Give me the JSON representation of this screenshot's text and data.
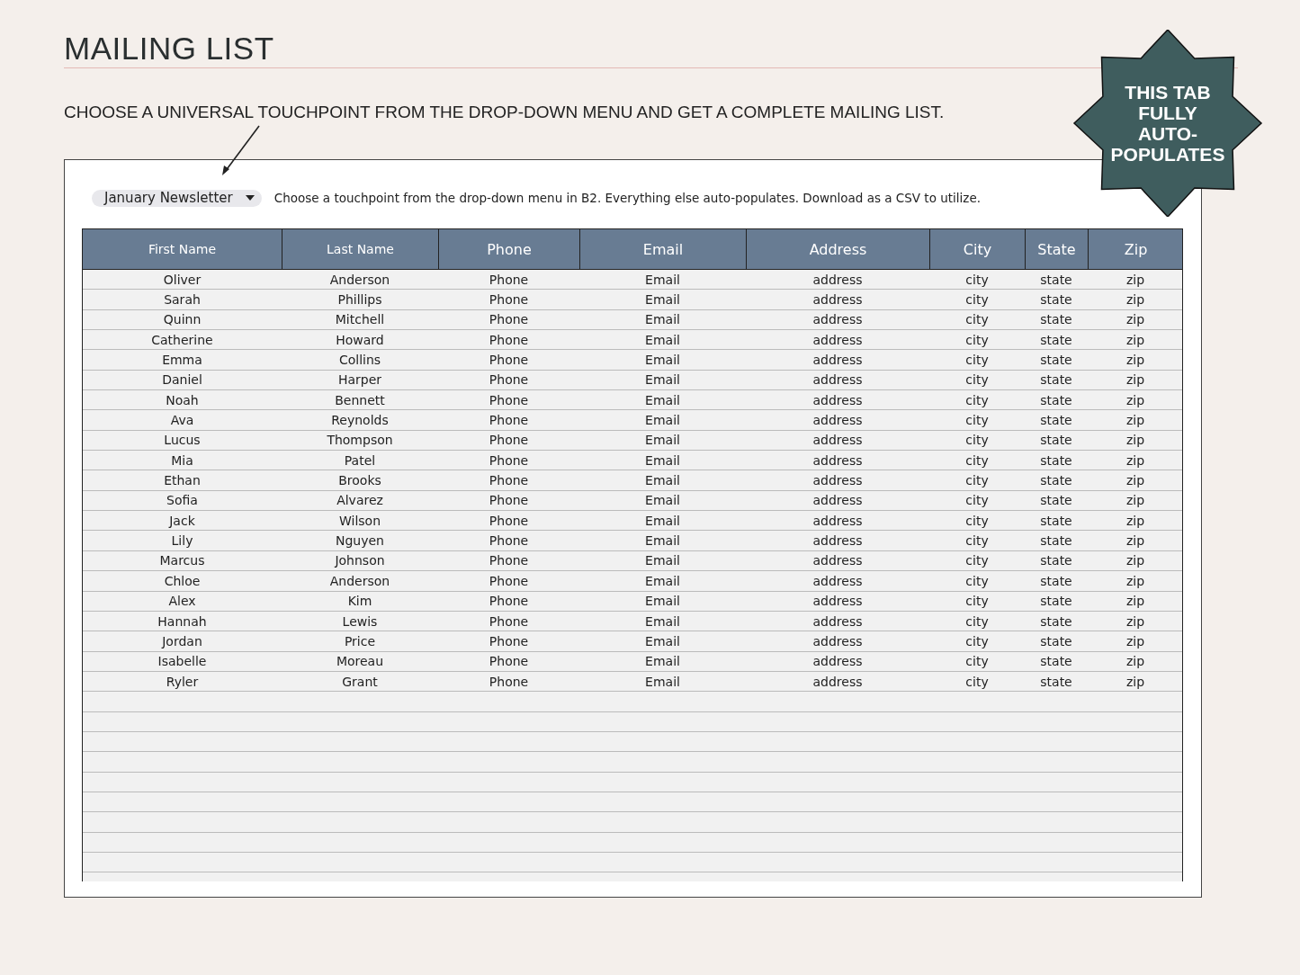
{
  "title": "MAILING LIST",
  "instruction": "CHOOSE A UNIVERSAL TOUCHPOINT FROM THE DROP-DOWN MENU AND GET A COMPLETE MAILING LIST.",
  "badge": [
    "THIS TAB",
    "FULLY",
    "AUTO-",
    "POPULATES"
  ],
  "touchpoint_dropdown": {
    "value": "January Newsletter"
  },
  "note": "Choose a touchpoint from the drop-down menu in B2. Everything else auto-populates. Download as a CSV to utilize.",
  "table": {
    "columns": [
      "First Name",
      "Last Name",
      "Phone",
      "Email",
      "Address",
      "City",
      "State",
      "Zip"
    ],
    "rows": [
      [
        "Oliver",
        "Anderson",
        "Phone",
        "Email",
        "address",
        "city",
        "state",
        "zip"
      ],
      [
        "Sarah",
        "Phillips",
        "Phone",
        "Email",
        "address",
        "city",
        "state",
        "zip"
      ],
      [
        "Quinn",
        "Mitchell",
        "Phone",
        "Email",
        "address",
        "city",
        "state",
        "zip"
      ],
      [
        "Catherine",
        "Howard",
        "Phone",
        "Email",
        "address",
        "city",
        "state",
        "zip"
      ],
      [
        "Emma",
        "Collins",
        "Phone",
        "Email",
        "address",
        "city",
        "state",
        "zip"
      ],
      [
        "Daniel",
        "Harper",
        "Phone",
        "Email",
        "address",
        "city",
        "state",
        "zip"
      ],
      [
        "Noah",
        "Bennett",
        "Phone",
        "Email",
        "address",
        "city",
        "state",
        "zip"
      ],
      [
        "Ava",
        "Reynolds",
        "Phone",
        "Email",
        "address",
        "city",
        "state",
        "zip"
      ],
      [
        "Lucus",
        "Thompson",
        "Phone",
        "Email",
        "address",
        "city",
        "state",
        "zip"
      ],
      [
        "Mia",
        "Patel",
        "Phone",
        "Email",
        "address",
        "city",
        "state",
        "zip"
      ],
      [
        "Ethan",
        "Brooks",
        "Phone",
        "Email",
        "address",
        "city",
        "state",
        "zip"
      ],
      [
        "Sofia",
        "Alvarez",
        "Phone",
        "Email",
        "address",
        "city",
        "state",
        "zip"
      ],
      [
        "Jack",
        "Wilson",
        "Phone",
        "Email",
        "address",
        "city",
        "state",
        "zip"
      ],
      [
        "Lily",
        "Nguyen",
        "Phone",
        "Email",
        "address",
        "city",
        "state",
        "zip"
      ],
      [
        "Marcus",
        "Johnson",
        "Phone",
        "Email",
        "address",
        "city",
        "state",
        "zip"
      ],
      [
        "Chloe",
        "Anderson",
        "Phone",
        "Email",
        "address",
        "city",
        "state",
        "zip"
      ],
      [
        "Alex",
        "Kim",
        "Phone",
        "Email",
        "address",
        "city",
        "state",
        "zip"
      ],
      [
        "Hannah",
        "Lewis",
        "Phone",
        "Email",
        "address",
        "city",
        "state",
        "zip"
      ],
      [
        "Jordan",
        "Price",
        "Phone",
        "Email",
        "address",
        "city",
        "state",
        "zip"
      ],
      [
        "Isabelle",
        "Moreau",
        "Phone",
        "Email",
        "address",
        "city",
        "state",
        "zip"
      ],
      [
        "Ryler",
        "Grant",
        "Phone",
        "Email",
        "address",
        "city",
        "state",
        "zip"
      ]
    ]
  }
}
